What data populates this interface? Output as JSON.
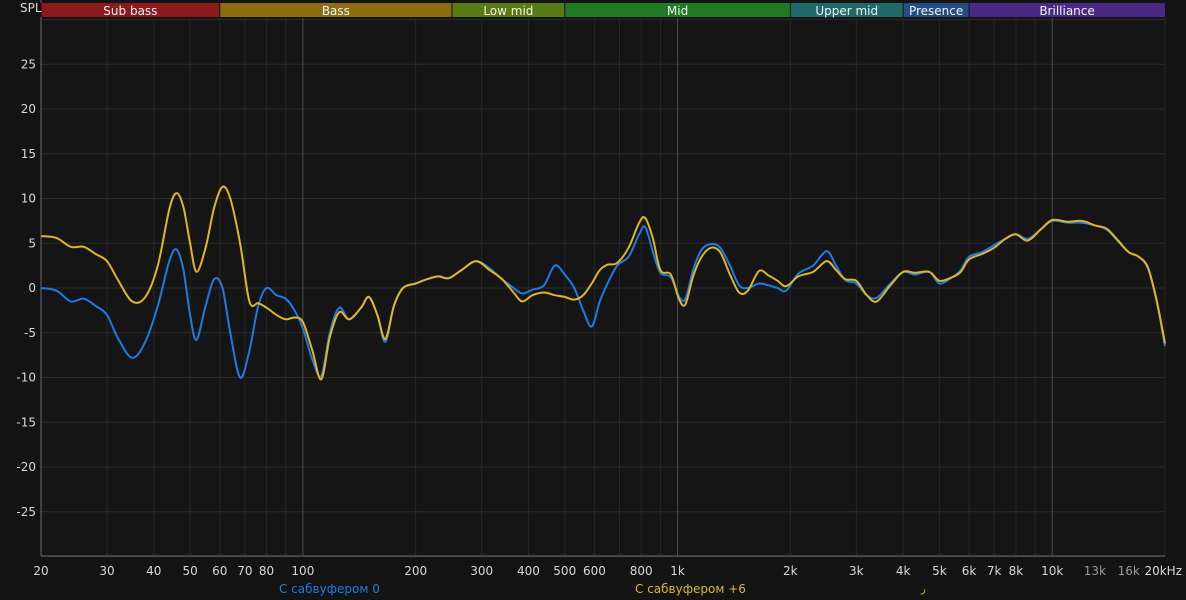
{
  "chart_data": {
    "type": "line",
    "ylabel": "SPL",
    "xscale": "log",
    "xlim": [
      20,
      20000
    ],
    "ylim": [
      -30,
      30
    ],
    "grid": true,
    "x_ticks": [
      {
        "v": 20,
        "label": "20",
        "major": true
      },
      {
        "v": 30,
        "label": "30",
        "major": true
      },
      {
        "v": 40,
        "label": "40",
        "major": true
      },
      {
        "v": 50,
        "label": "50",
        "major": true
      },
      {
        "v": 60,
        "label": "60",
        "major": true
      },
      {
        "v": 70,
        "label": "70",
        "major": true
      },
      {
        "v": 80,
        "label": "80",
        "major": true
      },
      {
        "v": 90,
        "label": "",
        "major": false
      },
      {
        "v": 100,
        "label": "100",
        "major": true
      },
      {
        "v": 200,
        "label": "200",
        "major": true
      },
      {
        "v": 300,
        "label": "300",
        "major": true
      },
      {
        "v": 400,
        "label": "400",
        "major": true
      },
      {
        "v": 500,
        "label": "500",
        "major": true
      },
      {
        "v": 600,
        "label": "600",
        "major": true
      },
      {
        "v": 700,
        "label": "",
        "major": false
      },
      {
        "v": 800,
        "label": "800",
        "major": true
      },
      {
        "v": 900,
        "label": "",
        "major": false
      },
      {
        "v": 1000,
        "label": "1k",
        "major": true
      },
      {
        "v": 2000,
        "label": "2k",
        "major": true
      },
      {
        "v": 3000,
        "label": "3k",
        "major": true
      },
      {
        "v": 4000,
        "label": "4k",
        "major": true
      },
      {
        "v": 5000,
        "label": "5k",
        "major": true
      },
      {
        "v": 6000,
        "label": "6k",
        "major": true
      },
      {
        "v": 7000,
        "label": "7k",
        "major": true
      },
      {
        "v": 8000,
        "label": "8k",
        "major": true
      },
      {
        "v": 9000,
        "label": "",
        "major": false
      },
      {
        "v": 10000,
        "label": "10k",
        "major": true
      },
      {
        "v": 13000,
        "label": "13k",
        "major": false
      },
      {
        "v": 16000,
        "label": "16k",
        "major": false
      },
      {
        "v": 20000,
        "label": "20kHz",
        "major": true
      }
    ],
    "y_ticks": [
      25,
      20,
      15,
      10,
      5,
      0,
      -5,
      -10,
      -15,
      -20,
      -25
    ],
    "bands": [
      {
        "name": "Sub bass",
        "from": 20,
        "to": 60,
        "color": "#8b1a1f"
      },
      {
        "name": "Bass",
        "from": 60,
        "to": 250,
        "color": "#8a6d12"
      },
      {
        "name": "Low mid",
        "from": 250,
        "to": 500,
        "color": "#5a7a14"
      },
      {
        "name": "Mid",
        "from": 500,
        "to": 2000,
        "color": "#1e7a23"
      },
      {
        "name": "Upper mid",
        "from": 2000,
        "to": 4000,
        "color": "#1f6a68"
      },
      {
        "name": "Presence",
        "from": 4000,
        "to": 6000,
        "color": "#234d84"
      },
      {
        "name": "Brilliance",
        "from": 6000,
        "to": 20000,
        "color": "#4b2a86"
      }
    ],
    "series": [
      {
        "name": "С сабвуфером 0",
        "color": "#1e7be6",
        "points": [
          [
            20,
            0
          ],
          [
            22,
            -0.3
          ],
          [
            24,
            -1.5
          ],
          [
            26,
            -1.2
          ],
          [
            28,
            -2
          ],
          [
            30,
            -3
          ],
          [
            32,
            -5.5
          ],
          [
            35,
            -7.8
          ],
          [
            38,
            -6
          ],
          [
            41,
            -2
          ],
          [
            44,
            3
          ],
          [
            46,
            4.3
          ],
          [
            48,
            2
          ],
          [
            50,
            -3
          ],
          [
            52,
            -5.8
          ],
          [
            55,
            -2
          ],
          [
            58,
            1
          ],
          [
            61,
            0
          ],
          [
            64,
            -5
          ],
          [
            68,
            -10
          ],
          [
            72,
            -7
          ],
          [
            76,
            -2
          ],
          [
            80,
            0
          ],
          [
            85,
            -0.8
          ],
          [
            90,
            -1.2
          ],
          [
            95,
            -2.5
          ],
          [
            100,
            -4.5
          ],
          [
            106,
            -8
          ],
          [
            112,
            -9.8
          ],
          [
            118,
            -5
          ],
          [
            125,
            -2.2
          ],
          [
            133,
            -3.5
          ],
          [
            143,
            -2.2
          ],
          [
            150,
            -1
          ],
          [
            158,
            -3
          ],
          [
            166,
            -6
          ],
          [
            175,
            -2
          ],
          [
            185,
            0
          ],
          [
            200,
            0.5
          ],
          [
            215,
            1
          ],
          [
            230,
            1.3
          ],
          [
            245,
            1.1
          ],
          [
            265,
            2
          ],
          [
            290,
            3
          ],
          [
            315,
            2.2
          ],
          [
            340,
            1
          ],
          [
            365,
            0
          ],
          [
            385,
            -0.6
          ],
          [
            410,
            -0.2
          ],
          [
            440,
            0.3
          ],
          [
            470,
            2.5
          ],
          [
            500,
            1.5
          ],
          [
            530,
            0
          ],
          [
            560,
            -2.5
          ],
          [
            590,
            -4.3
          ],
          [
            620,
            -1.5
          ],
          [
            650,
            0.5
          ],
          [
            690,
            2.5
          ],
          [
            740,
            3.5
          ],
          [
            790,
            6
          ],
          [
            820,
            6.8
          ],
          [
            860,
            4
          ],
          [
            900,
            1.7
          ],
          [
            960,
            1.2
          ],
          [
            1010,
            -1
          ],
          [
            1050,
            -1.2
          ],
          [
            1100,
            2
          ],
          [
            1160,
            4.3
          ],
          [
            1230,
            4.9
          ],
          [
            1300,
            4.5
          ],
          [
            1380,
            2.5
          ],
          [
            1460,
            0.3
          ],
          [
            1540,
            0
          ],
          [
            1650,
            0.5
          ],
          [
            1750,
            0.3
          ],
          [
            1850,
            0
          ],
          [
            1950,
            -0.3
          ],
          [
            2100,
            1.6
          ],
          [
            2300,
            2.5
          ],
          [
            2500,
            4.1
          ],
          [
            2650,
            2.5
          ],
          [
            2800,
            0.9
          ],
          [
            3000,
            0.5
          ],
          [
            3200,
            -0.8
          ],
          [
            3400,
            -1.1
          ],
          [
            3700,
            0.5
          ],
          [
            4000,
            1.8
          ],
          [
            4300,
            1.5
          ],
          [
            4700,
            1.8
          ],
          [
            5000,
            0.5
          ],
          [
            5400,
            1.2
          ],
          [
            5700,
            2
          ],
          [
            6000,
            3.5
          ],
          [
            6500,
            4
          ],
          [
            7000,
            4.8
          ],
          [
            7500,
            5.5
          ],
          [
            8000,
            6
          ],
          [
            8600,
            5.5
          ],
          [
            9300,
            6.5
          ],
          [
            10000,
            7.5
          ],
          [
            11000,
            7.3
          ],
          [
            12000,
            7.3
          ],
          [
            13000,
            7
          ],
          [
            14000,
            6.5
          ],
          [
            15000,
            5.2
          ],
          [
            16000,
            4
          ],
          [
            17000,
            3.5
          ],
          [
            18000,
            2.2
          ],
          [
            19000,
            -1.5
          ],
          [
            20000,
            -6.5
          ]
        ]
      },
      {
        "name": "С сабвуфером +6",
        "color": "#e0b624",
        "points": [
          [
            20,
            5.8
          ],
          [
            22,
            5.6
          ],
          [
            24,
            4.6
          ],
          [
            26,
            4.6
          ],
          [
            28,
            3.8
          ],
          [
            30,
            3
          ],
          [
            32,
            1
          ],
          [
            35,
            -1.5
          ],
          [
            38,
            -1
          ],
          [
            41,
            2.5
          ],
          [
            44,
            8.8
          ],
          [
            46,
            10.6
          ],
          [
            48,
            9
          ],
          [
            50,
            5
          ],
          [
            52,
            1.8
          ],
          [
            55,
            4.5
          ],
          [
            58,
            9
          ],
          [
            61,
            11.3
          ],
          [
            64,
            10
          ],
          [
            68,
            5
          ],
          [
            72,
            -1.5
          ],
          [
            76,
            -1.7
          ],
          [
            80,
            -2.2
          ],
          [
            85,
            -3
          ],
          [
            90,
            -3.5
          ],
          [
            95,
            -3.3
          ],
          [
            100,
            -3.8
          ],
          [
            106,
            -7
          ],
          [
            112,
            -10.2
          ],
          [
            118,
            -5.5
          ],
          [
            125,
            -2.7
          ],
          [
            133,
            -3.5
          ],
          [
            143,
            -2.2
          ],
          [
            150,
            -1
          ],
          [
            158,
            -3
          ],
          [
            166,
            -5.7
          ],
          [
            175,
            -2
          ],
          [
            185,
            0
          ],
          [
            200,
            0.5
          ],
          [
            215,
            1
          ],
          [
            230,
            1.3
          ],
          [
            245,
            1.1
          ],
          [
            265,
            2
          ],
          [
            290,
            3
          ],
          [
            315,
            2
          ],
          [
            340,
            1
          ],
          [
            365,
            -0.5
          ],
          [
            385,
            -1.5
          ],
          [
            410,
            -0.8
          ],
          [
            440,
            -0.5
          ],
          [
            470,
            -0.8
          ],
          [
            500,
            -1
          ],
          [
            530,
            -1.3
          ],
          [
            560,
            -0.8
          ],
          [
            590,
            0.5
          ],
          [
            620,
            2
          ],
          [
            650,
            2.6
          ],
          [
            690,
            2.8
          ],
          [
            740,
            4.5
          ],
          [
            790,
            7.3
          ],
          [
            820,
            7.8
          ],
          [
            860,
            5.5
          ],
          [
            900,
            2
          ],
          [
            960,
            1.5
          ],
          [
            1010,
            -1.3
          ],
          [
            1050,
            -1.8
          ],
          [
            1100,
            1.3
          ],
          [
            1160,
            3.5
          ],
          [
            1230,
            4.5
          ],
          [
            1300,
            4
          ],
          [
            1380,
            1.5
          ],
          [
            1460,
            -0.5
          ],
          [
            1540,
            -0.3
          ],
          [
            1650,
            1.9
          ],
          [
            1750,
            1.4
          ],
          [
            1850,
            0.8
          ],
          [
            1950,
            0.2
          ],
          [
            2100,
            1.3
          ],
          [
            2300,
            1.8
          ],
          [
            2500,
            3
          ],
          [
            2650,
            2
          ],
          [
            2800,
            1
          ],
          [
            3000,
            0.8
          ],
          [
            3200,
            -0.8
          ],
          [
            3400,
            -1.5
          ],
          [
            3700,
            0.3
          ],
          [
            4000,
            1.8
          ],
          [
            4300,
            1.7
          ],
          [
            4700,
            1.8
          ],
          [
            5000,
            0.8
          ],
          [
            5400,
            1.2
          ],
          [
            5700,
            1.8
          ],
          [
            6000,
            3.2
          ],
          [
            6500,
            3.8
          ],
          [
            7000,
            4.5
          ],
          [
            7500,
            5.5
          ],
          [
            8000,
            6
          ],
          [
            8600,
            5.3
          ],
          [
            9300,
            6.5
          ],
          [
            10000,
            7.6
          ],
          [
            11000,
            7.4
          ],
          [
            12000,
            7.5
          ],
          [
            13000,
            7
          ],
          [
            14000,
            6.6
          ],
          [
            15000,
            5.3
          ],
          [
            16000,
            4
          ],
          [
            17000,
            3.5
          ],
          [
            18000,
            2.3
          ],
          [
            19000,
            -1.4
          ],
          [
            20000,
            -6.2
          ]
        ]
      }
    ]
  },
  "legend_extra_mark": "ر"
}
